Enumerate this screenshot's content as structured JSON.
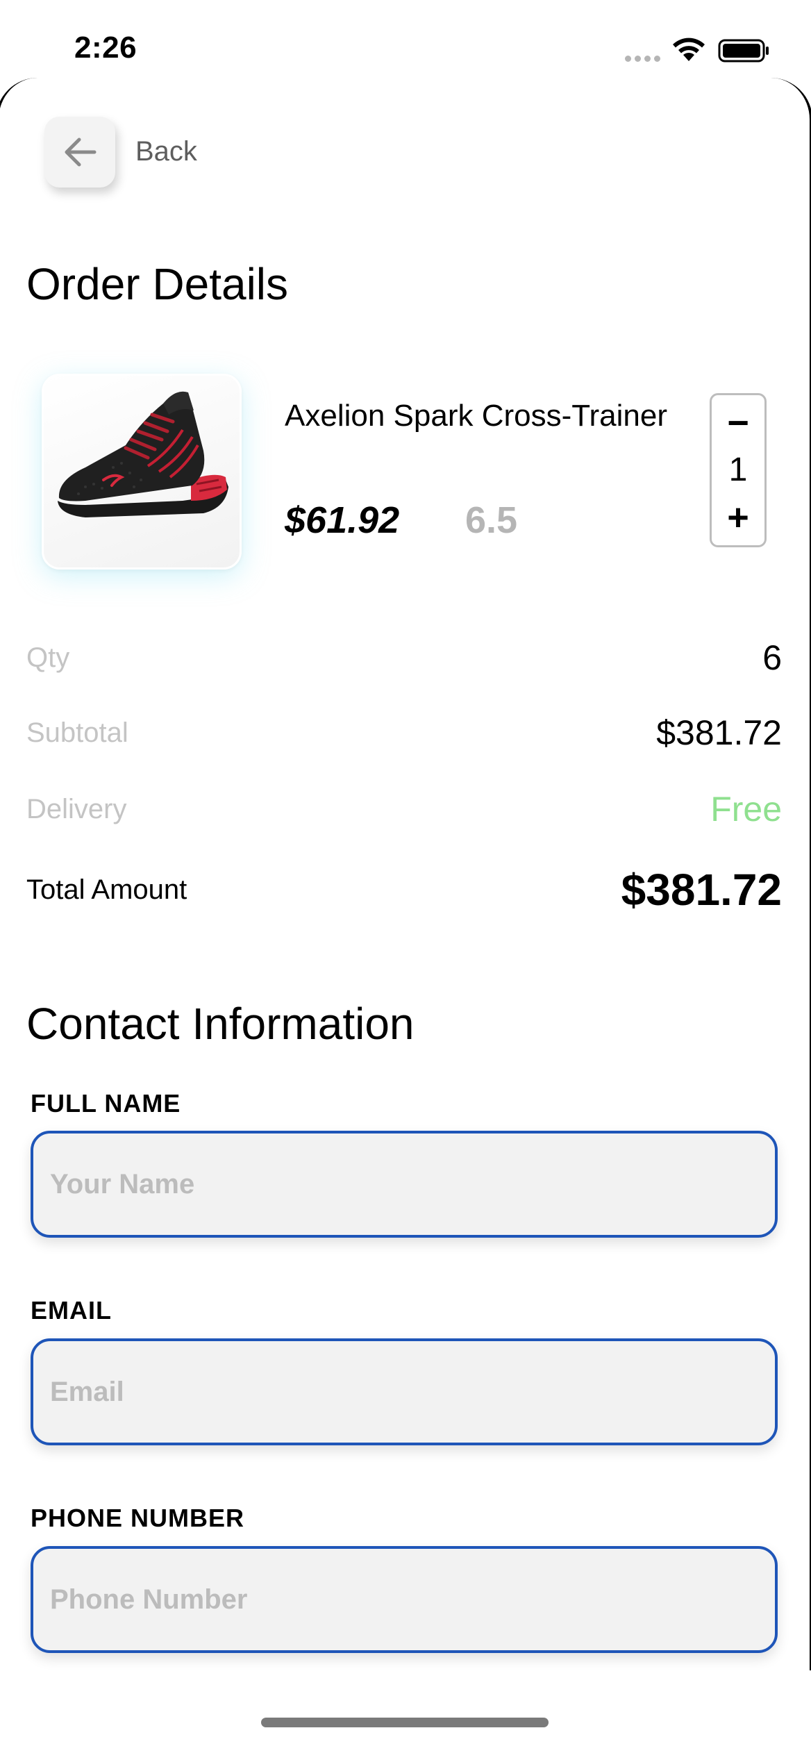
{
  "status_bar": {
    "time": "2:26",
    "icons": [
      "signal-dots-icon",
      "wifi-icon",
      "battery-icon"
    ]
  },
  "nav": {
    "back_label": "Back",
    "back_icon": "arrow-left-icon"
  },
  "order": {
    "title": "Order Details",
    "product": {
      "name": "Axelion Spark Cross-Trainer",
      "price": "$61.92",
      "size": "6.5",
      "image": "black-and-red-sneaker-image"
    },
    "stepper": {
      "decrement": "−",
      "value": "1",
      "increment": "+"
    },
    "summary": {
      "qty_label": "Qty",
      "qty_value": "6",
      "subtotal_label": "Subtotal",
      "subtotal_value": "$381.72",
      "delivery_label": "Delivery",
      "delivery_value": "Free",
      "total_label": "Total Amount",
      "total_value": "$381.72"
    }
  },
  "contact": {
    "title": "Contact Information",
    "full_name": {
      "label": "FULL NAME",
      "placeholder": "Your Name",
      "value": ""
    },
    "email": {
      "label": "EMAIL",
      "placeholder": "Email",
      "value": ""
    },
    "phone": {
      "label": "PHONE NUMBER",
      "placeholder": "Phone Number",
      "value": ""
    }
  },
  "colors": {
    "accent_border": "#1e55b8",
    "free_text": "#8fe08f",
    "muted_text": "#c4c4c4",
    "size_text": "#b5b5b5"
  }
}
